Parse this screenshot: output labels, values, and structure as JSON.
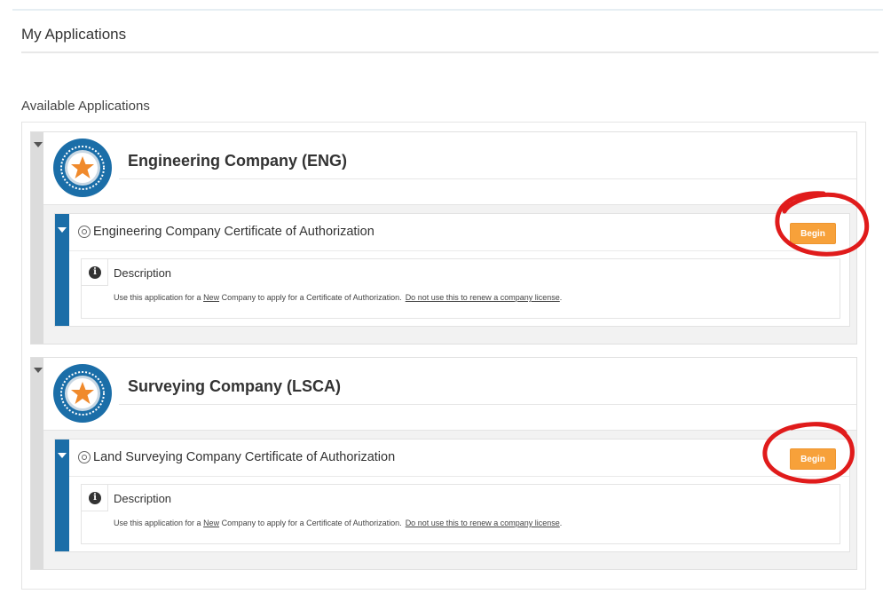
{
  "page": {
    "title": "My Applications"
  },
  "section": {
    "title": "Available Applications"
  },
  "colors": {
    "accent_blue": "#1b6ea8",
    "begin_orange": "#f7a13a",
    "annotation_red": "#e01b1b"
  },
  "groups": [
    {
      "title": "Engineering Company (ENG)",
      "badge_icon": "star-seal-icon",
      "application": {
        "title": "Engineering Company Certificate of Authorization",
        "begin_label": "Begin",
        "description_label": "Description",
        "description_prefix": "Use this application for a ",
        "description_new": "New",
        "description_middle": " Company to apply for a Certificate of Authorization.",
        "description_link": "Do not use this to renew a company license"
      }
    },
    {
      "title": "Surveying Company (LSCA)",
      "badge_icon": "star-seal-icon",
      "application": {
        "title": "Land Surveying Company Certificate of Authorization",
        "begin_label": "Begin",
        "description_label": "Description",
        "description_prefix": "Use this application for a ",
        "description_new": "New",
        "description_middle": " Company to apply for a Certificate of Authorization.",
        "description_link": "Do not use this to renew a company license"
      }
    }
  ]
}
